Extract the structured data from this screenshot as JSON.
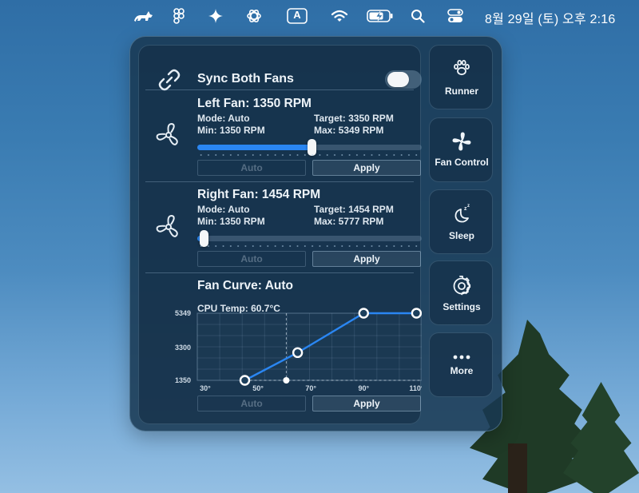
{
  "menubar": {
    "icons": [
      "cat-icon",
      "figma-icon",
      "sparkle-icon",
      "openai-icon",
      "input-source-icon",
      "wifi-icon",
      "battery-icon",
      "search-icon",
      "control-center-icon"
    ],
    "input_source_letter": "A",
    "clock": "8월 29일 (토) 오후 2:16"
  },
  "sync": {
    "label": "Sync Both Fans",
    "enabled": false
  },
  "left_fan": {
    "title": "Left Fan: 1350 RPM",
    "mode": "Mode: Auto",
    "target": "Target: 3350 RPM",
    "min": "Min: 1350 RPM",
    "max": "Max: 5349 RPM",
    "slider_fraction": 0.51,
    "auto_label": "Auto",
    "apply_label": "Apply"
  },
  "right_fan": {
    "title": "Right Fan: 1454 RPM",
    "mode": "Mode: Auto",
    "target": "Target: 1454 RPM",
    "min": "Min: 1350 RPM",
    "max": "Max: 5777 RPM",
    "slider_fraction": 0.03,
    "auto_label": "Auto",
    "apply_label": "Apply"
  },
  "fan_curve": {
    "title": "Fan Curve: Auto",
    "cpu_temp": "CPU Temp: 60.7°C",
    "auto_label": "Auto",
    "apply_label": "Apply"
  },
  "sidebar": {
    "items": [
      {
        "label": "Runner",
        "icon": "paw-icon"
      },
      {
        "label": "Fan Control",
        "icon": "fan-icon"
      },
      {
        "label": "Sleep",
        "icon": "moon-zz-icon"
      },
      {
        "label": "Settings",
        "icon": "gear-icon"
      },
      {
        "label": "More",
        "icon": "ellipsis-icon"
      }
    ]
  },
  "colors": {
    "accent": "#2a86f2",
    "panel": "#183852"
  },
  "chart_data": {
    "type": "line",
    "title": "Fan Curve: Auto",
    "x_ticks": [
      "30°",
      "50°",
      "70°",
      "90°",
      "110°"
    ],
    "y_ticks": [
      "1350",
      "3300",
      "5349"
    ],
    "xlim": [
      27,
      112
    ],
    "ylim": [
      1350,
      5349
    ],
    "series": [
      {
        "x": [
          45,
          65,
          90,
          110
        ],
        "y": [
          1350,
          3000,
          5349,
          5349
        ]
      }
    ],
    "current_temp_marker": 60.7,
    "grid": true
  }
}
